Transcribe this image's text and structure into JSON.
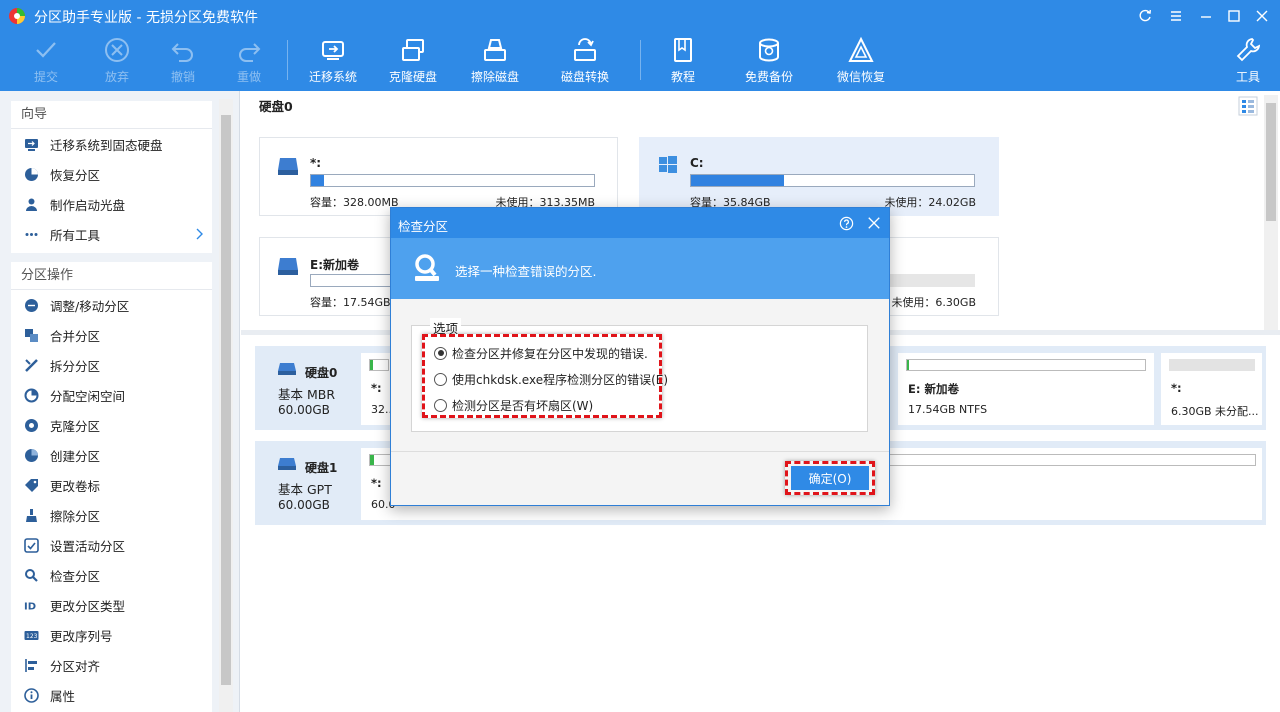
{
  "app": {
    "title": "分区助手专业版 - 无损分区免费软件"
  },
  "toolbar": [
    {
      "label": "提交",
      "icon": "check-icon",
      "disabled": true
    },
    {
      "label": "放弃",
      "icon": "cancel-circle-icon",
      "disabled": true
    },
    {
      "label": "撤销",
      "icon": "undo-icon",
      "disabled": true
    },
    {
      "label": "重做",
      "icon": "redo-icon",
      "disabled": true
    },
    {
      "label": "迁移系统",
      "icon": "migrate-os-icon"
    },
    {
      "label": "克隆硬盘",
      "icon": "clone-disk-icon"
    },
    {
      "label": "擦除磁盘",
      "icon": "wipe-disk-icon"
    },
    {
      "label": "磁盘转换",
      "icon": "convert-disk-icon"
    },
    {
      "label": "教程",
      "icon": "book-icon"
    },
    {
      "label": "免费备份",
      "icon": "backup-icon"
    },
    {
      "label": "微信恢复",
      "icon": "wechat-recovery-icon"
    },
    {
      "label": "工具",
      "icon": "tools-icon"
    }
  ],
  "sidebar": {
    "wizard": {
      "title": "向导",
      "items": [
        {
          "label": "迁移系统到固态硬盘",
          "icon": "migrate-icon"
        },
        {
          "label": "恢复分区",
          "icon": "recover-icon"
        },
        {
          "label": "制作启动光盘",
          "icon": "boot-disc-icon"
        },
        {
          "label": "所有工具",
          "icon": "dots-icon"
        }
      ]
    },
    "operations": {
      "title": "分区操作",
      "items": [
        {
          "label": "调整/移动分区",
          "icon": "resize-icon"
        },
        {
          "label": "合并分区",
          "icon": "merge-icon"
        },
        {
          "label": "拆分分区",
          "icon": "split-icon"
        },
        {
          "label": "分配空闲空间",
          "icon": "allocate-icon"
        },
        {
          "label": "克隆分区",
          "icon": "clone-icon"
        },
        {
          "label": "创建分区",
          "icon": "create-icon"
        },
        {
          "label": "更改卷标",
          "icon": "label-icon"
        },
        {
          "label": "擦除分区",
          "icon": "wipe-icon"
        },
        {
          "label": "设置活动分区",
          "icon": "active-icon"
        },
        {
          "label": "检查分区",
          "icon": "check-partition-icon"
        },
        {
          "label": "更改分区类型",
          "icon": "id-icon"
        },
        {
          "label": "更改序列号",
          "icon": "serial-icon"
        },
        {
          "label": "分区对齐",
          "icon": "align-icon"
        },
        {
          "label": "属性",
          "icon": "info-icon"
        }
      ]
    }
  },
  "main": {
    "disk0_title": "硬盘0",
    "cards": [
      {
        "name": "*:",
        "cap_label": "容量：328.00MB",
        "free_label": "未使用：313.35MB",
        "used_fraction": 0.045
      },
      {
        "name": "C:",
        "cap_label": "容量：35.84GB",
        "free_label": "未使用：24.02GB",
        "used_fraction": 0.33
      },
      {
        "name": "E:新加卷",
        "cap_label": "容量：17.54GB",
        "free_label": "",
        "used_fraction": 0.0
      },
      {
        "name": "",
        "cap_label": "",
        "free_label": "未使用：6.30GB",
        "used_fraction": 0.0
      }
    ],
    "map": [
      {
        "disk": "硬盘0",
        "type": "基本 MBR",
        "size": "60.00GB",
        "parts": [
          {
            "name": "*:",
            "info": "32..."
          },
          {
            "name": "E: 新加卷",
            "info": "17.54GB NTFS"
          },
          {
            "name": "*:",
            "info": "6.30GB 未分配..."
          }
        ]
      },
      {
        "disk": "硬盘1",
        "type": "基本 GPT",
        "size": "60.00GB",
        "parts": [
          {
            "name": "*:",
            "info": "60.0"
          }
        ]
      }
    ]
  },
  "dialog": {
    "title": "检查分区",
    "help_icon": "help-icon",
    "banner_text": "选择一种检查错误的分区.",
    "group_label": "选项",
    "options": [
      {
        "label": "检查分区并修复在分区中发现的错误.",
        "checked": true
      },
      {
        "label": "使用chkdsk.exe程序检测分区的错误(E)",
        "checked": false
      },
      {
        "label": "检测分区是否有坏扇区(W)",
        "checked": false
      }
    ],
    "ok_label": "确定(O)"
  },
  "colors": {
    "accent": "#2f8ae6",
    "highlight": "#e0141a",
    "bar_fill": "#3182e0",
    "bar_green": "#39b54a"
  }
}
